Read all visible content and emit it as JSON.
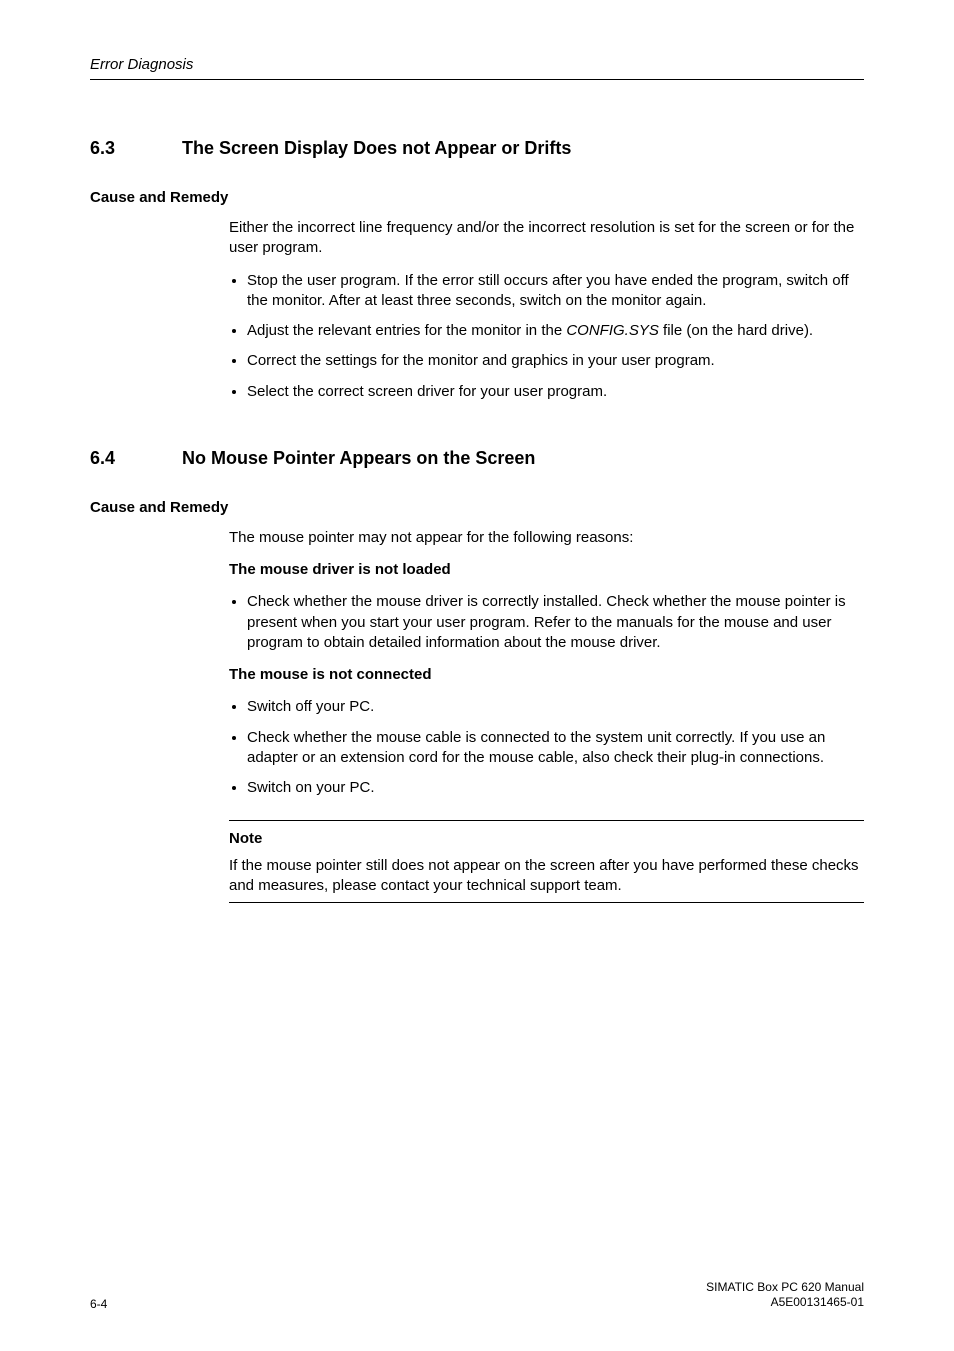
{
  "running_head": "Error Diagnosis",
  "sec63": {
    "num": "6.3",
    "title": "The Screen Display Does not Appear or Drifts",
    "cause_head": "Cause and Remedy",
    "intro": "Either the incorrect line frequency and/or the incorrect resolution is set for the screen or for the user program.",
    "b1": "Stop the user program. If the error still occurs after you have ended the program, switch off the monitor. After at least three seconds, switch on the monitor again.",
    "b2a": "Adjust the relevant entries for the monitor in the ",
    "b2file": "CONFIG.SYS",
    "b2b": " file (on the hard drive).",
    "b3": "Correct the settings for the monitor and graphics in your user program.",
    "b4": "Select the correct screen driver for your user program."
  },
  "sec64": {
    "num": "6.4",
    "title": "No Mouse Pointer Appears on the Screen",
    "cause_head": "Cause and Remedy",
    "intro": "The mouse pointer may not appear for the following reasons:",
    "sub1": "The mouse driver is not loaded",
    "b1": "Check whether the mouse driver is correctly installed. Check whether the mouse pointer is present when you start your user program. Refer to the manuals for the mouse and user program to obtain detailed information about the mouse driver.",
    "sub2": "The mouse is not connected",
    "b2": "Switch off your PC.",
    "b3": "Check whether the mouse cable is connected to the system unit correctly. If you use an adapter or an extension cord for the mouse cable, also check their plug-in connections.",
    "b4": "Switch on your PC.",
    "note_label": "Note",
    "note_body": "If the mouse pointer still does not appear on the screen after you have performed these checks and measures, please contact your technical support team."
  },
  "footer": {
    "page": "6-4",
    "r1": "SIMATIC Box PC 620  Manual",
    "r2": "A5E00131465-01"
  }
}
